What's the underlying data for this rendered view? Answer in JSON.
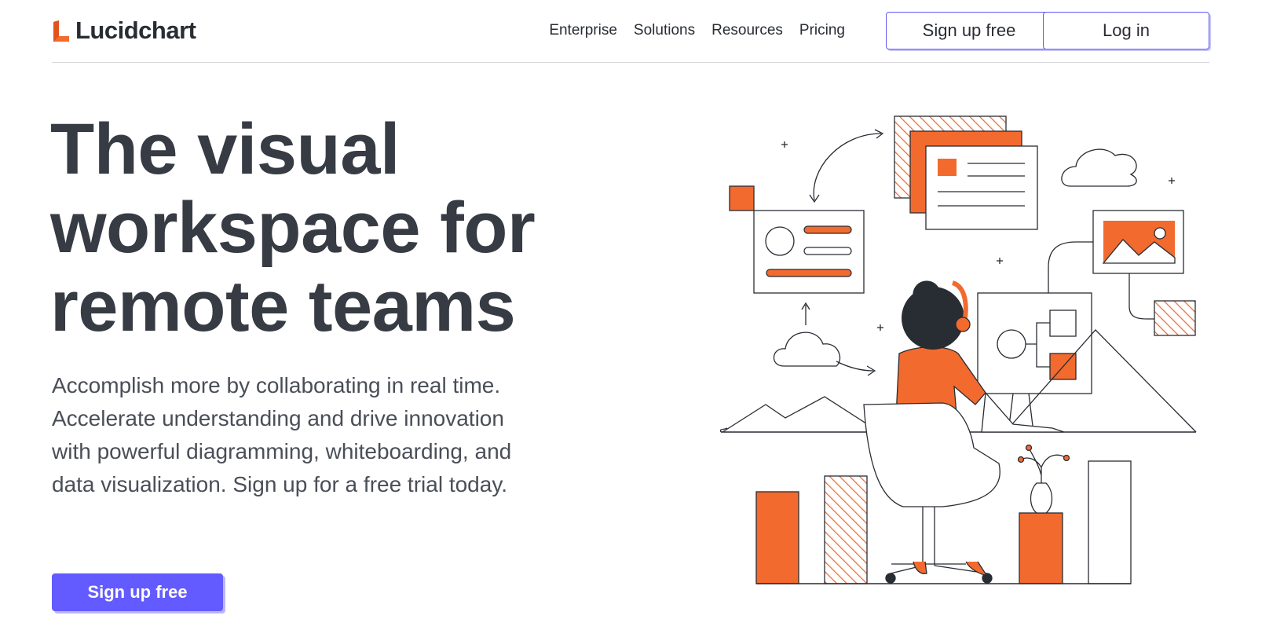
{
  "brand": {
    "name": "Lucidchart",
    "accent": "#f26a2e",
    "primary": "#635bff",
    "text": "#282c33"
  },
  "nav": {
    "links": [
      "Enterprise",
      "Solutions",
      "Resources",
      "Pricing"
    ],
    "signup_label": "Sign up free",
    "login_label": "Log in"
  },
  "hero": {
    "title_line1": "The visual",
    "title_line2": "workspace for",
    "title_line3": "remote teams",
    "description": "Accomplish more by collaborating in real time. Accelerate understanding and drive innovation with powerful diagramming, whiteboarding, and data visualization. Sign up for a free trial today.",
    "cta_label": "Sign up free"
  },
  "illustration": {
    "icon": "remote-worker-illustration"
  }
}
